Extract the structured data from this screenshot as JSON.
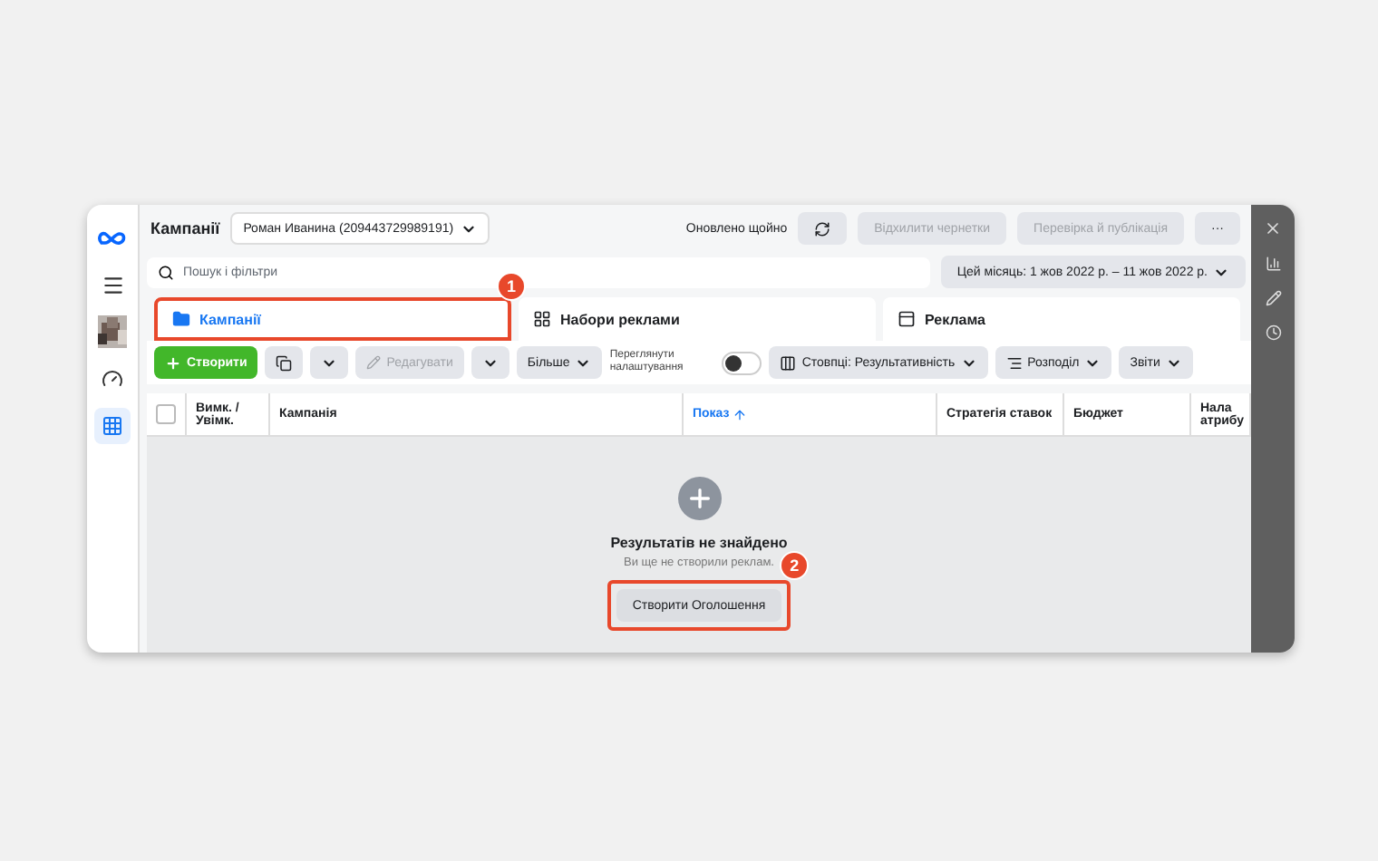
{
  "header": {
    "title": "Кампанії",
    "account": "Роман Иванина (209443729989191)",
    "status": "Оновлено щойно",
    "buttons": [
      {
        "label": "Відхилити чернетки",
        "disabled": true
      },
      {
        "label": "Перевірка й публікація",
        "disabled": true
      }
    ],
    "more": "···"
  },
  "search": {
    "placeholder": "Пошук і фільтри"
  },
  "date_range": "Цей місяць: 1 жов 2022 р. – 11 жов 2022 р.",
  "nav": [
    {
      "kind": "logo",
      "selected": false
    },
    {
      "kind": "menu",
      "selected": false
    },
    {
      "kind": "avatar",
      "selected": false
    },
    {
      "kind": "gauge",
      "selected": false
    },
    {
      "kind": "grid",
      "selected": true
    }
  ],
  "tabs": [
    {
      "label": "Кампанії",
      "kind": "folder",
      "selected": true,
      "callout": "1"
    },
    {
      "label": "Набори реклами",
      "kind": "sets",
      "selected": false
    },
    {
      "label": "Реклама",
      "kind": "ad",
      "selected": false
    }
  ],
  "toolbar": {
    "create": "Створити",
    "edit": {
      "label": "Редагувати",
      "disabled": true
    },
    "more": "Більше",
    "view_settings": {
      "label": "Переглянути налаштування",
      "on": false
    },
    "columns": "Стовпці: Результативність",
    "breakdown": "Розподіл",
    "reports": "Звіти"
  },
  "table": {
    "select_all": {
      "checked": false
    },
    "columns": [
      {
        "label": "Вимк. / Увімк.",
        "sorted": false
      },
      {
        "label": "Кампанія",
        "sorted": false
      },
      {
        "label": "Показ",
        "sorted": true
      },
      {
        "label": "Стратегія ставок",
        "sorted": false
      },
      {
        "label": "Бюджет",
        "sorted": false
      },
      {
        "label": "Нала атрибу",
        "sorted": false
      }
    ]
  },
  "empty_state": {
    "title": "Результатів не знайдено",
    "subtitle": "Ви ще не створили реклам.",
    "button": "Створити Оголошення",
    "callout": "2"
  },
  "side_panel": [
    {
      "kind": "close"
    },
    {
      "kind": "chart"
    },
    {
      "kind": "pencil"
    },
    {
      "kind": "clock"
    }
  ]
}
